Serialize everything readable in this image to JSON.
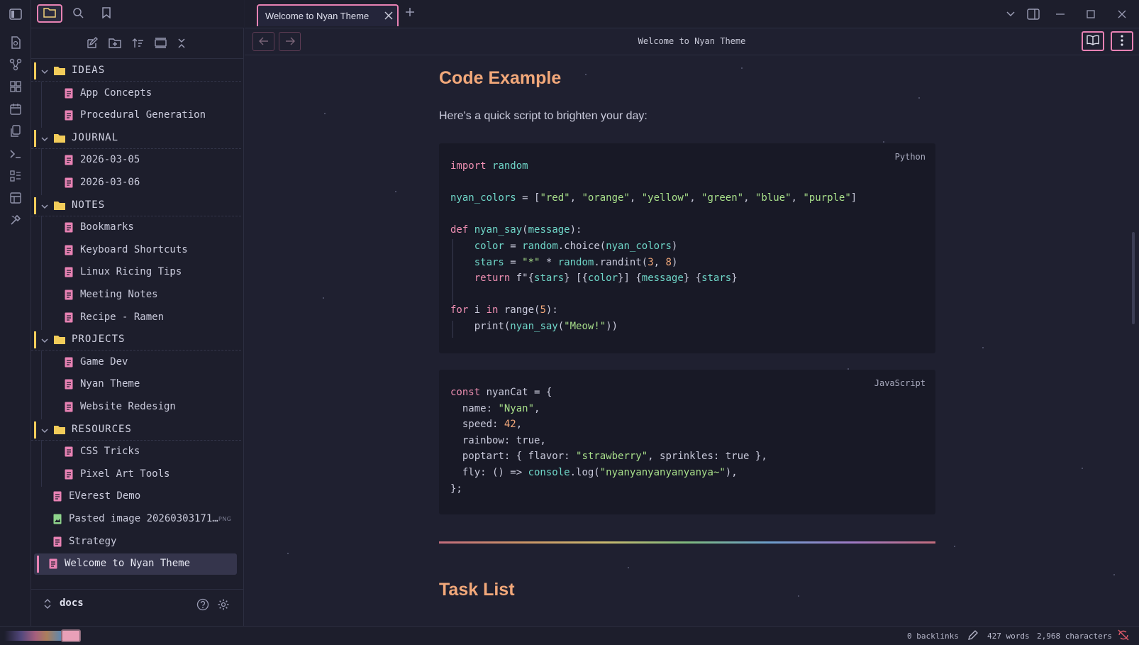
{
  "window": {
    "tab_title": "Welcome to Nyan Theme",
    "view_title": "Welcome to Nyan Theme",
    "new_tab": "+",
    "close": "✕"
  },
  "sidebar": {
    "tree": [
      {
        "type": "folder",
        "label": "IDEAS",
        "children": [
          "App Concepts",
          "Procedural Generation"
        ]
      },
      {
        "type": "folder",
        "label": "JOURNAL",
        "children": [
          "2026-03-05",
          "2026-03-06"
        ]
      },
      {
        "type": "folder",
        "label": "NOTES",
        "children": [
          "Bookmarks",
          "Keyboard Shortcuts",
          "Linux Ricing Tips",
          "Meeting Notes",
          "Recipe - Ramen"
        ]
      },
      {
        "type": "folder",
        "label": "PROJECTS",
        "children": [
          "Game Dev",
          "Nyan Theme",
          "Website Redesign"
        ]
      },
      {
        "type": "folder",
        "label": "RESOURCES",
        "children": [
          "CSS Tricks",
          "Pixel Art Tools"
        ]
      }
    ],
    "root_files": [
      {
        "label": "EVerest Demo",
        "kind": "md"
      },
      {
        "label": "Pasted image 20260303171…",
        "kind": "png",
        "badge": "PNG"
      },
      {
        "label": "Strategy",
        "kind": "md"
      }
    ],
    "active_file": "Welcome to Nyan Theme",
    "vault_name": "docs"
  },
  "content": {
    "heading_code": "Code Example",
    "intro": "Here's a quick script to brighten your day:",
    "python": {
      "lang": "Python",
      "lines": [
        "import random",
        "",
        "nyan_colors = [\"red\", \"orange\", \"yellow\", \"green\", \"blue\", \"purple\"]",
        "",
        "def nyan_say(message):",
        "    color = random.choice(nyan_colors)",
        "    stars = \"*\" * random.randint(3, 8)",
        "    return f\"{stars} [{color}] {message} {stars}\"",
        "",
        "for i in range(5):",
        "    print(nyan_say(\"Meow!\"))"
      ]
    },
    "javascript": {
      "lang": "JavaScript",
      "lines": [
        "const nyanCat = {",
        "  name: \"Nyan\",",
        "  speed: 42,",
        "  rainbow: true,",
        "  poptart: { flavor: \"strawberry\", sprinkles: true },",
        "  fly: () => console.log(\"nyanyanyanyanyanya~\"),",
        "};"
      ]
    },
    "heading_task": "Task List"
  },
  "status": {
    "backlinks": "0 backlinks",
    "words": "427 words",
    "characters": "2,968 characters"
  },
  "colors": {
    "accent_pink": "#e882b4",
    "folder_yellow": "#f2cc5a",
    "heading_orange": "#f2a87a",
    "keyword": "#ee8fb2",
    "function": "#6fd6c8",
    "string": "#a8df8a"
  },
  "icons": {
    "ribbon": [
      "sidebar-toggle-icon",
      "file-open-icon",
      "graph-icon",
      "canvas-icon",
      "calendar-icon",
      "templates-icon",
      "terminal-icon",
      "bases-icon",
      "layout-icon",
      "theme-tools-icon"
    ]
  }
}
